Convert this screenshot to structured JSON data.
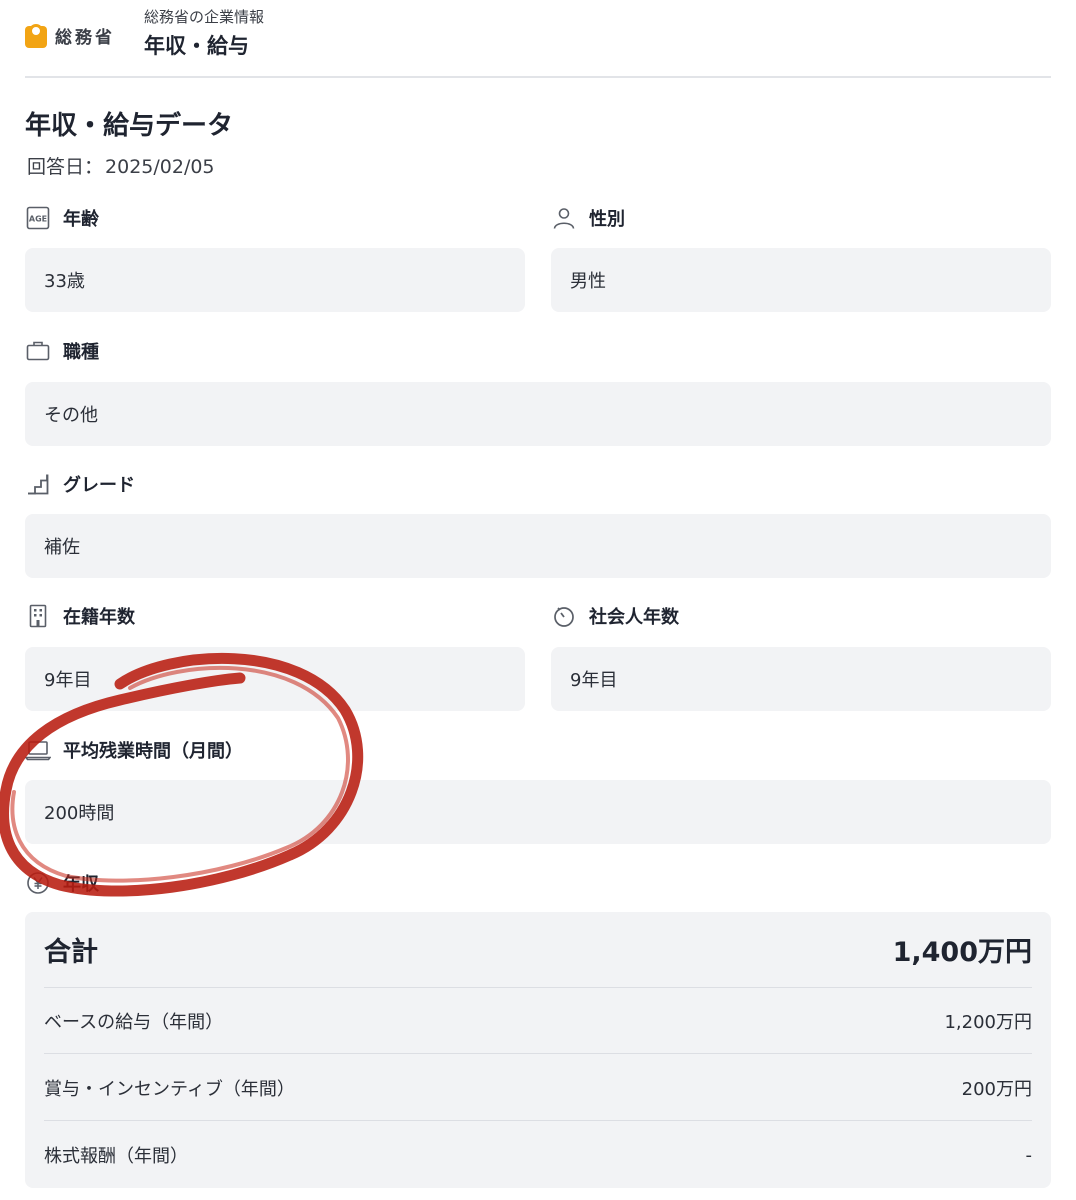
{
  "header": {
    "logo_text": "総務省",
    "company_subtitle": "総務省の企業情報",
    "page_name": "年収・給与"
  },
  "section": {
    "title": "年収・給与データ",
    "answer_date_label": "回答日：",
    "answer_date": "2025/02/05"
  },
  "fields": {
    "age": {
      "label": "年齢",
      "value": "33歳",
      "icon": "age-icon"
    },
    "gender": {
      "label": "性別",
      "value": "男性",
      "icon": "person-icon"
    },
    "job_type": {
      "label": "職種",
      "value": "その他",
      "icon": "briefcase-icon"
    },
    "grade": {
      "label": "グレード",
      "value": "補佐",
      "icon": "stairs-icon"
    },
    "tenure": {
      "label": "在籍年数",
      "value": "9年目",
      "icon": "building-icon"
    },
    "career_years": {
      "label": "社会人年数",
      "value": "9年目",
      "icon": "timer-icon"
    },
    "overtime": {
      "label": "平均残業時間（月間）",
      "value": "200時間",
      "icon": "laptop-icon"
    },
    "annual_income": {
      "label": "年収",
      "icon": "yen-icon"
    }
  },
  "income": {
    "total_label": "合計",
    "total_value": "1,400万円",
    "rows": [
      {
        "label": "ベースの給与（年間）",
        "value": "1,200万円"
      },
      {
        "label": "賞与・インセンティブ（年間）",
        "value": "200万円"
      },
      {
        "label": "株式報酬（年間）",
        "value": "-"
      }
    ]
  },
  "colors": {
    "brand_orange": "#f2a414",
    "field_bg": "#f2f3f5",
    "annotation_red": "#b81c10"
  }
}
